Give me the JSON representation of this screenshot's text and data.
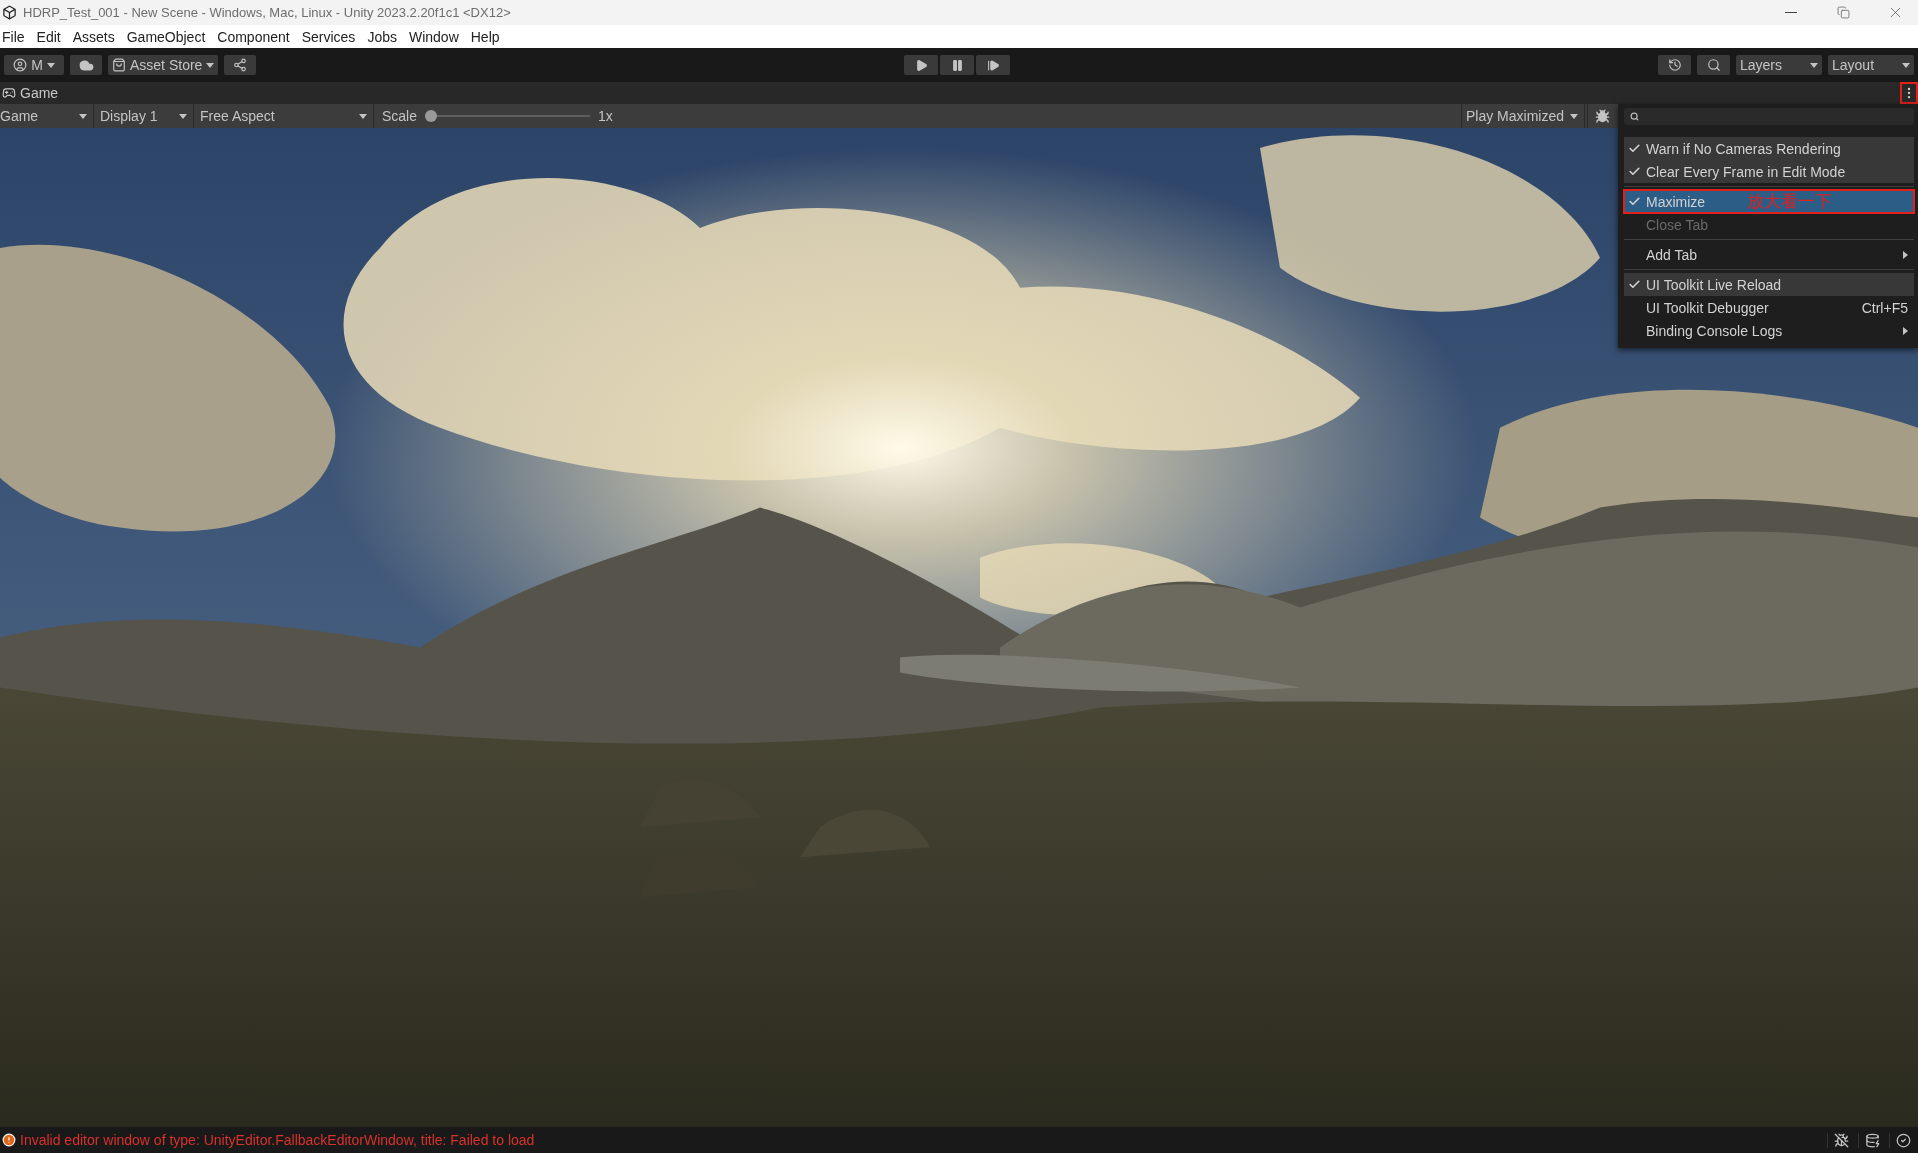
{
  "window": {
    "title": "HDRP_Test_001 - New Scene - Windows, Mac, Linux - Unity 2023.2.20f1c1 <DX12>"
  },
  "menu_bar": [
    "File",
    "Edit",
    "Assets",
    "GameObject",
    "Component",
    "Services",
    "Jobs",
    "Window",
    "Help"
  ],
  "toolbar": {
    "account": "M",
    "asset_store": "Asset Store",
    "layers": "Layers",
    "layout": "Layout"
  },
  "game_tab": {
    "title": "Game",
    "menu_button_annotated": true
  },
  "game_toolbar": {
    "view": "Game",
    "display": "Display 1",
    "aspect": "Free Aspect",
    "scale_label": "Scale",
    "scale": {
      "level": 0.0
    },
    "scale_value": "1x",
    "play_mode": "Play Maximized"
  },
  "context_menu": {
    "sections": [
      [
        {
          "kind": "toggle",
          "label": "Warn if No Cameras Rendering",
          "checked": true,
          "selected": false,
          "disabled": false
        },
        {
          "kind": "toggle",
          "label": "Clear Every Frame in Edit Mode",
          "checked": true,
          "selected": false,
          "disabled": false
        }
      ],
      [
        {
          "kind": "toggle",
          "label": "Maximize",
          "checked": true,
          "selected": true,
          "disabled": false,
          "annotation": "放大看一下"
        },
        {
          "kind": "action",
          "label": "Close Tab",
          "checked": false,
          "selected": false,
          "disabled": true
        }
      ],
      [
        {
          "kind": "submenu",
          "label": "Add Tab",
          "checked": false,
          "selected": false,
          "disabled": false
        }
      ],
      [
        {
          "kind": "toggle",
          "label": "UI Toolkit Live Reload",
          "checked": true,
          "selected": false,
          "disabled": false
        },
        {
          "kind": "action",
          "label": "UI Toolkit Debugger",
          "shortcut": "Ctrl+F5",
          "checked": false,
          "selected": false,
          "disabled": false
        },
        {
          "kind": "submenu",
          "label": "Binding Console Logs",
          "checked": false,
          "selected": false,
          "disabled": false
        }
      ]
    ]
  },
  "status_bar": {
    "message": "Invalid editor window of type: UnityEditor.FallbackEditorWindow, title: Failed to load"
  }
}
